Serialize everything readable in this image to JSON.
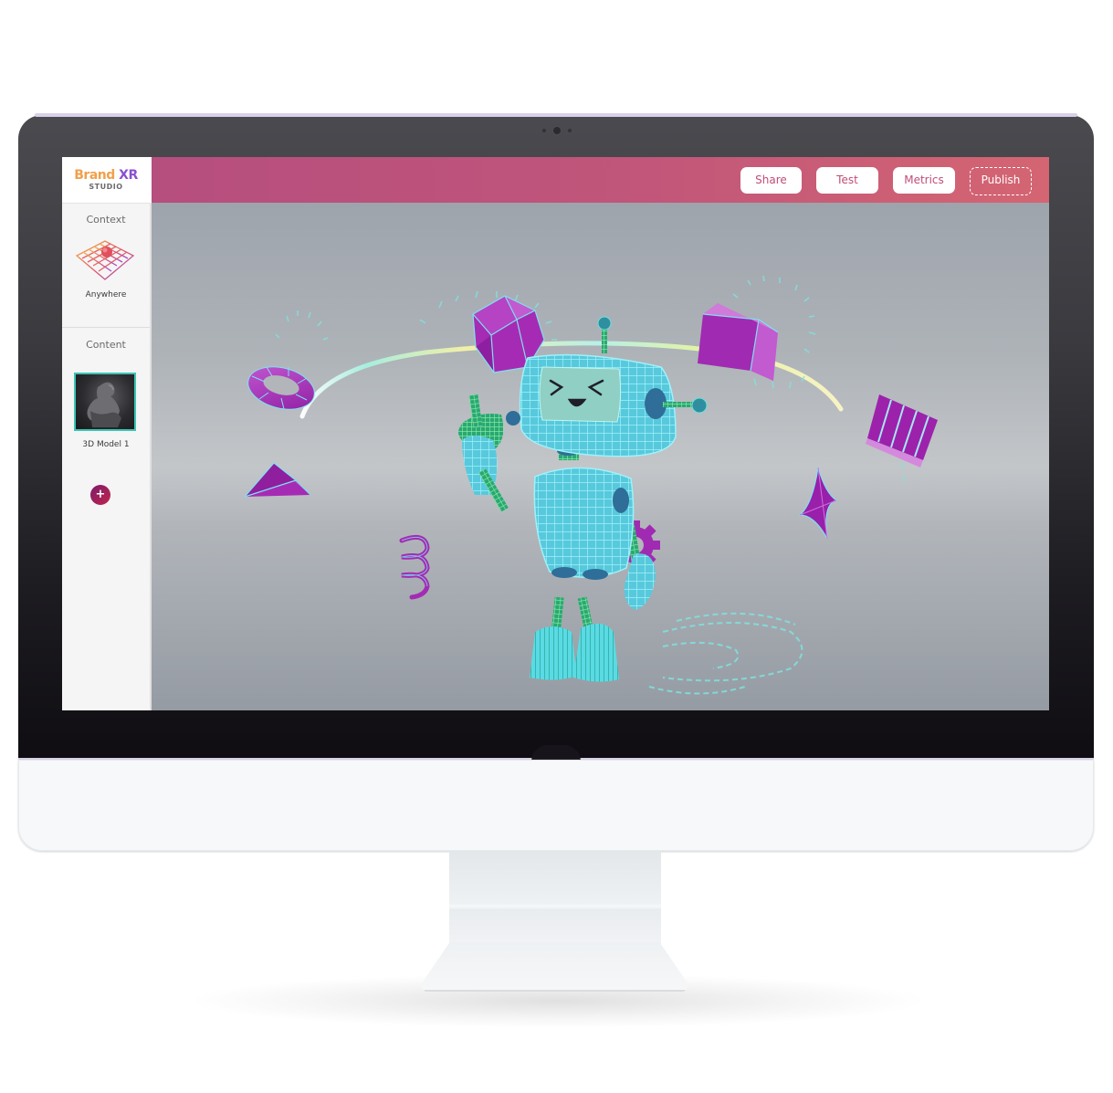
{
  "app": {
    "logo": {
      "brand_part1": "Brand",
      "brand_part2": "XR",
      "subtitle": "STUDIO"
    },
    "topbar": {
      "buttons": [
        {
          "label": "Share",
          "style": "filled"
        },
        {
          "label": "Test",
          "style": "filled"
        },
        {
          "label": "Metrics",
          "style": "filled"
        },
        {
          "label": "Publish",
          "style": "dashed-outline"
        }
      ]
    },
    "sidebar": {
      "context": {
        "heading": "Context",
        "item_label": "Anywhere",
        "icon": "grid-plane-icon"
      },
      "content": {
        "heading": "Content",
        "items": [
          {
            "label": "3D Model 1",
            "thumbnail": "thinker-statue-thumbnail",
            "selected": true
          }
        ]
      },
      "add_button_symbol": "+"
    },
    "viewport": {
      "scene_description": "Wireframe cyan robot with floating purple geometric shapes and a glowing arc",
      "objects": [
        "robot",
        "icosahedron",
        "torus",
        "tetrahedron",
        "spring",
        "cube",
        "striped-box",
        "four-point-star",
        "gear",
        "light-arc",
        "ground-ripples"
      ],
      "robot_face": ">_<"
    }
  },
  "colors": {
    "topbar_start": "#b64e7e",
    "topbar_end": "#d46572",
    "button_text": "#c04d78",
    "accent_teal": "#3cc5b4",
    "shape_purple": "#a32bb4",
    "robot_cyan": "#5fd8ea",
    "logo_orange": "#f0a04b",
    "logo_purple": "#8a4fd0"
  },
  "device": {
    "type": "desktop-monitor-mockup"
  }
}
